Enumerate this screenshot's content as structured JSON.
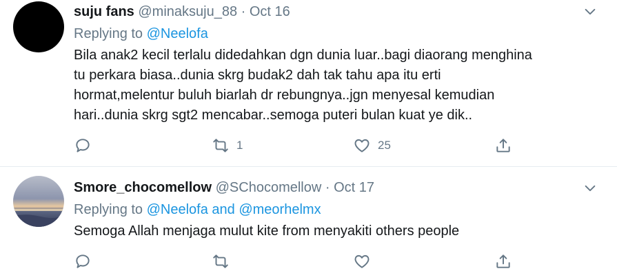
{
  "tweets": [
    {
      "name": "suju fans",
      "handle": "@minaksuju_88",
      "dot": "·",
      "date": "Oct 16",
      "replying_prefix": "Replying to ",
      "replying_to": "@Neelofa",
      "lines": [
        "Bila anak2 kecil terlalu didedahkan dgn dunia luar..bagi diaorang menghina",
        "tu perkara biasa..dunia skrg budak2 dah tak tahu apa itu erti",
        "hormat,melentur buluh biarlah dr rebungnya..jgn menyesal kemudian",
        "hari..dunia skrg sgt2 mencabar..semoga puteri bulan kuat ye dik.."
      ],
      "retweets": "1",
      "likes": "25"
    },
    {
      "name": "Smore_chocomellow",
      "handle": "@SChocomellow",
      "dot": "·",
      "date": "Oct 17",
      "replying_prefix": "Replying to ",
      "replying_to": "@Neelofa and @meorhelmx",
      "lines": [
        "Semoga Allah menjaga mulut kite from menyakiti others people"
      ],
      "retweets": "",
      "likes": ""
    }
  ],
  "icons": {
    "reply": "reply-icon",
    "retweet": "retweet-icon",
    "like": "like-icon",
    "share": "share-icon",
    "caret": "chevron-down-icon"
  },
  "colors": {
    "mention": "#1b95e0",
    "secondary": "#657786",
    "divider": "#e6ecf0"
  }
}
